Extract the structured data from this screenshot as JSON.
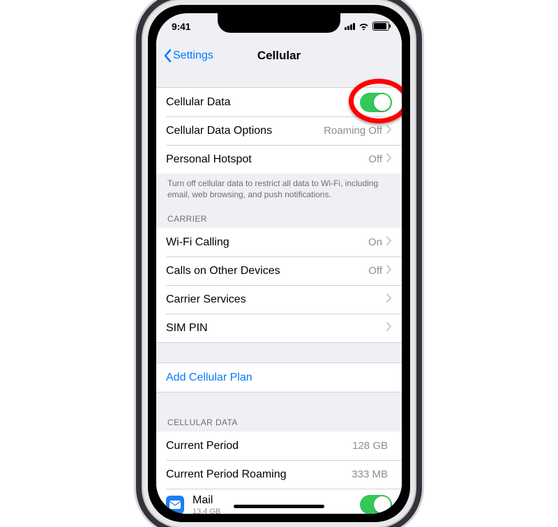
{
  "status": {
    "time": "9:41"
  },
  "nav": {
    "back": "Settings",
    "title": "Cellular"
  },
  "rows": {
    "cellular_data": "Cellular Data",
    "cellular_data_options": {
      "label": "Cellular Data Options",
      "value": "Roaming Off"
    },
    "personal_hotspot": {
      "label": "Personal Hotspot",
      "value": "Off"
    }
  },
  "footer_main": "Turn off cellular data to restrict all data to Wi-Fi, including email, web browsing, and push notifications.",
  "carrier": {
    "header": "CARRIER",
    "wifi_calling": {
      "label": "Wi-Fi Calling",
      "value": "On"
    },
    "calls_other": {
      "label": "Calls on Other Devices",
      "value": "Off"
    },
    "carrier_services": "Carrier Services",
    "sim_pin": "SIM PIN"
  },
  "add_plan": "Add Cellular Plan",
  "usage": {
    "header": "CELLULAR DATA",
    "current_period": {
      "label": "Current Period",
      "value": "128 GB"
    },
    "current_period_roaming": {
      "label": "Current Period Roaming",
      "value": "333 MB"
    },
    "mail": {
      "label": "Mail",
      "sub": "13.4 GB"
    }
  },
  "colors": {
    "accent": "#007aff",
    "toggle_on": "#34c759",
    "annotation": "#ff0000"
  }
}
